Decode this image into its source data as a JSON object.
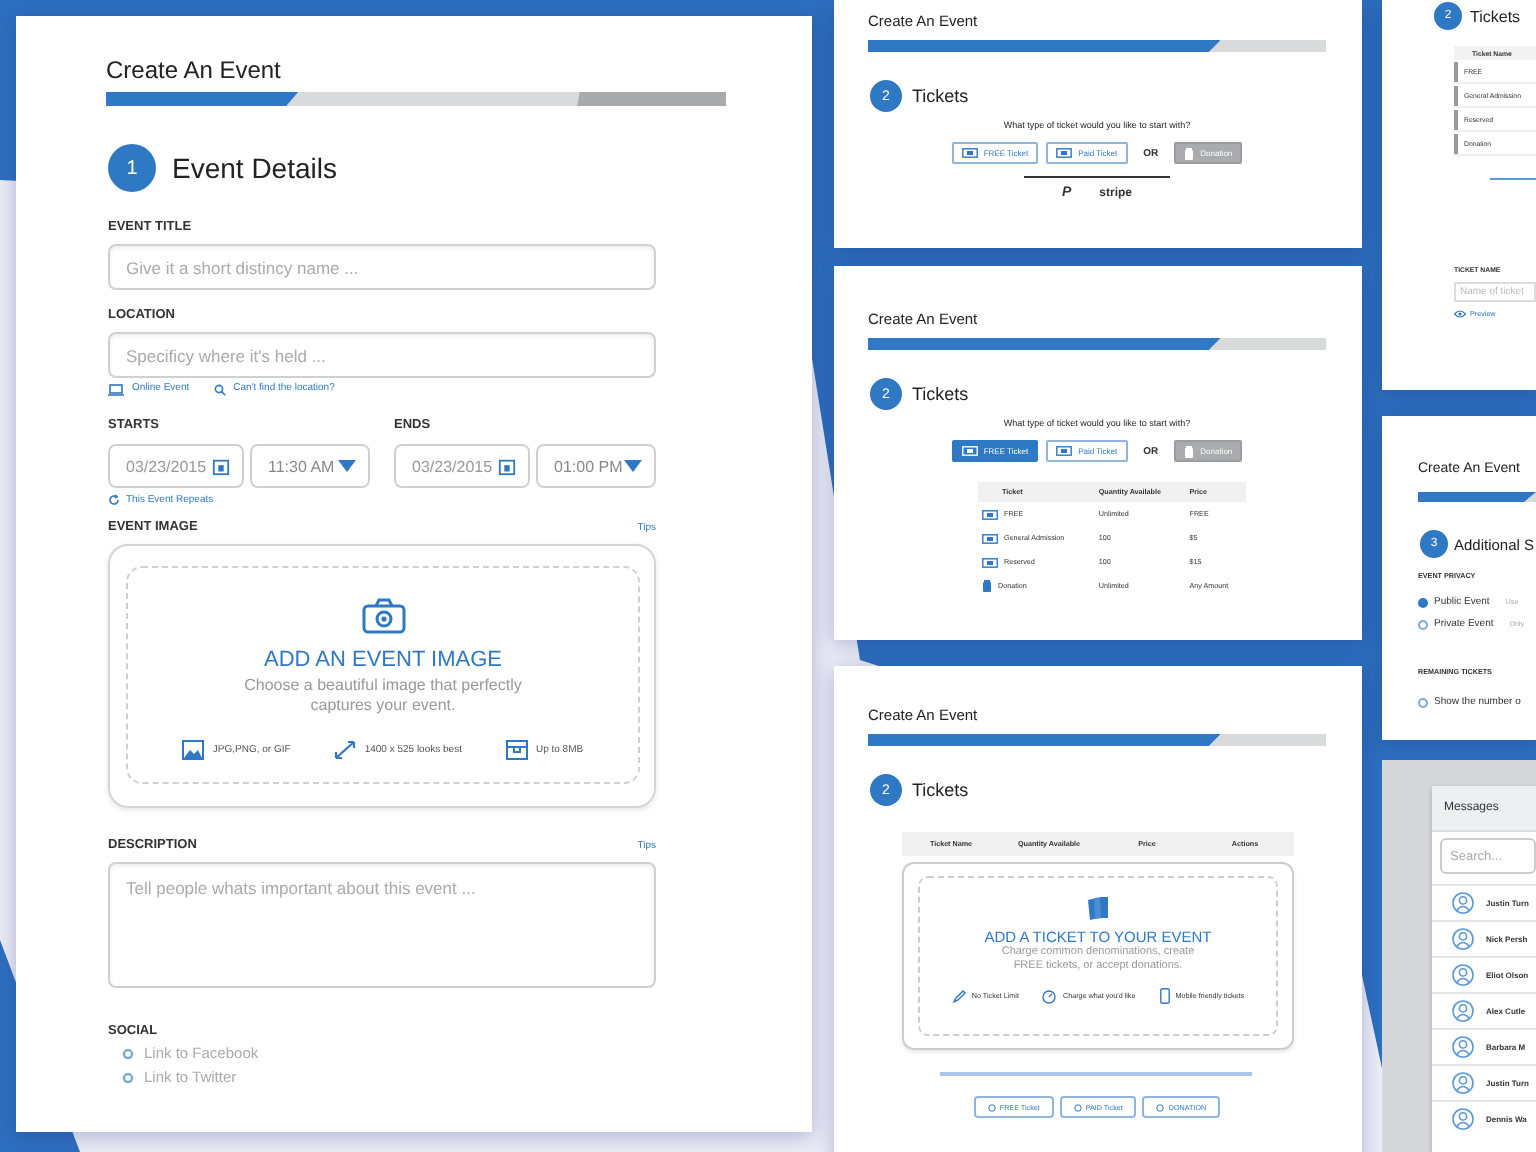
{
  "event_details": {
    "header": "Create An Event",
    "progress": {
      "level": 0.31
    },
    "step": {
      "number": "1",
      "title": "Event Details"
    },
    "event_title": {
      "label": "EVENT TITLE",
      "placeholder": "Give it a short distincy name ..."
    },
    "location": {
      "label": "LOCATION",
      "placeholder": "Specificy where it's held ...",
      "links": [
        "Online Event",
        "Can't find the location?"
      ]
    },
    "starts": {
      "label": "STARTS",
      "date": "03/23/2015",
      "time": "11:30 AM"
    },
    "ends": {
      "label": "ENDS",
      "date": "03/23/2015",
      "time": "01:00 PM"
    },
    "repeat_link": "This Event Repeats",
    "event_image": {
      "label": "EVENT IMAGE",
      "tips": "Tips",
      "heading": "ADD AN EVENT IMAGE",
      "text": "Choose a beautiful image that perfectly captures your event.",
      "hints": [
        "JPG,PNG, or GIF",
        "1400 x 525 looks best",
        "Up to 8MB"
      ]
    },
    "description": {
      "label": "DESCRIPTION",
      "tips": "Tips",
      "placeholder": "Tell people whats important about this event ..."
    },
    "social": {
      "label": "SOCIAL",
      "links": [
        "Link to Facebook",
        "Link to Twitter"
      ]
    }
  },
  "ticket_panels": [
    {
      "kind": "choice",
      "header": "Create An Event",
      "progress": {
        "level": 0.77
      },
      "step": {
        "number": "2",
        "title": "Tickets"
      },
      "question": "What type of ticket would you like to start with?",
      "options": [
        {
          "label": "FREE Ticket",
          "selected": false
        },
        {
          "label": "Paid Ticket",
          "selected": false
        }
      ],
      "or": "OR",
      "donation": "Donation",
      "payments": [
        "P",
        "stripe"
      ]
    },
    {
      "kind": "table",
      "header": "Create An Event",
      "progress": {
        "level": 0.77
      },
      "step": {
        "number": "2",
        "title": "Tickets"
      },
      "question": "What type of ticket would you like to start with?",
      "options": [
        {
          "label": "FREE Ticket",
          "selected": true
        },
        {
          "label": "Paid Ticket",
          "selected": false
        }
      ],
      "or": "OR",
      "donation": "Donation",
      "columns": [
        "Ticket",
        "Quantity Available",
        "Price"
      ],
      "rows": [
        {
          "kind": "free",
          "cells": [
            "FREE",
            "Unlimited",
            "FREE"
          ]
        },
        {
          "kind": "paid",
          "cells": [
            "General Admission",
            "100",
            "$5"
          ]
        },
        {
          "kind": "paid",
          "cells": [
            "Reserved",
            "100",
            "$15"
          ]
        },
        {
          "kind": "donation",
          "cells": [
            "Donation",
            "Unlimited",
            "Any Amount"
          ]
        }
      ]
    },
    {
      "kind": "empty",
      "header": "Create An Event",
      "progress": {
        "level": 0.77
      },
      "step": {
        "number": "2",
        "title": "Tickets"
      },
      "columns": [
        "Ticket Name",
        "Quantity Available",
        "Price",
        "Actions"
      ],
      "heading": "ADD A TICKET TO YOUR EVENT",
      "text": "Charge common denominations, create FREE tickets, or accept donations.",
      "features": [
        "No Ticket Limit",
        "Charge what you'd like",
        "Mobile friendly tickets"
      ],
      "buttons": [
        "FREE Ticket",
        "PAID Ticket",
        "DONATION"
      ]
    }
  ],
  "ticket_editor": {
    "step": {
      "number": "2",
      "title": "Tickets"
    },
    "column": "Ticket Name",
    "rows": [
      "FREE",
      "General Admission",
      "Reserved",
      "Donation"
    ],
    "name_label": "TICKET NAME",
    "name_placeholder": "Name of ticket",
    "preview": "Preview"
  },
  "additional_settings": {
    "header": "Create An Event",
    "progress": {
      "level": 1
    },
    "step": {
      "number": "3",
      "title": "Additional S"
    },
    "privacy_label": "EVENT PRIVACY",
    "privacy_options": [
      {
        "label": "Public Event",
        "note": "Use",
        "selected": true
      },
      {
        "label": "Private Event",
        "note": "Only",
        "selected": false
      }
    ],
    "remaining_label": "REMAINING TICKETS",
    "remaining_option": {
      "label": "Show the number o",
      "checked": false
    }
  },
  "messages": {
    "title": "Messages",
    "search_placeholder": "Search...",
    "contacts": [
      "Justin Turn",
      "Nick Persh",
      "Eliot Olson",
      "Alex Cutle",
      "Barbara M",
      "Justin Turn",
      "Dennis Wa"
    ]
  }
}
